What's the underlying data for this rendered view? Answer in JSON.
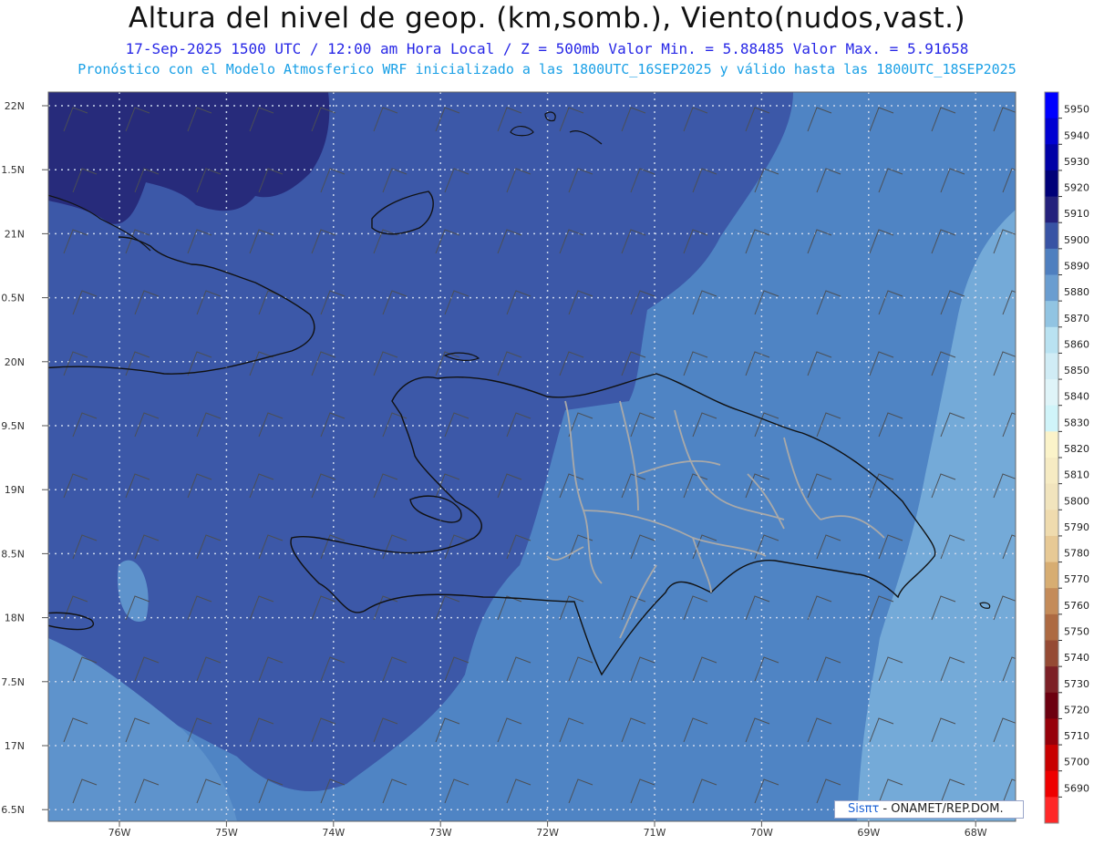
{
  "header": {
    "title": "Altura del nivel de geop. (km,somb.), Viento(nudos,vast.)",
    "subtitle": "17-Sep-2025  1500 UTC / 12:00 am Hora Local / Z = 500mb    Valor Min. = 5.88485  Valor Max. = 5.91658",
    "forecast": "Pronóstico con el Modelo Atmosferico WRF inicializado a las 1800UTC_16SEP2025 y válido hasta las  1800UTC_18SEP2025"
  },
  "axes": {
    "lat_ticks": [
      "22N",
      "1.5N",
      "21N",
      "0.5N",
      "20N",
      "9.5N",
      "19N",
      "8.5N",
      "18N",
      "7.5N",
      "17N",
      "6.5N"
    ],
    "lon_ticks": [
      "76W",
      "75W",
      "74W",
      "73W",
      "72W",
      "71W",
      "70W",
      "69W",
      "68W"
    ]
  },
  "colorbar": {
    "levels": [
      5950,
      5940,
      5930,
      5920,
      5910,
      5900,
      5890,
      5880,
      5870,
      5860,
      5850,
      5840,
      5830,
      5820,
      5810,
      5800,
      5790,
      5780,
      5770,
      5760,
      5750,
      5740,
      5730,
      5720,
      5710,
      5700,
      5690
    ],
    "colors": [
      "#0000ff",
      "#0000d2",
      "#0000a6",
      "#000078",
      "#24217c",
      "#3853a4",
      "#4f7fbf",
      "#6a9dd0",
      "#91c4e2",
      "#b9e2f1",
      "#d0ecf5",
      "#dff4f8",
      "#d0f4f9",
      "#fbf3c9",
      "#f6ebc3",
      "#f1e4bd",
      "#efdbae",
      "#e7c995",
      "#d7ad72",
      "#c48b59",
      "#ad6a42",
      "#954a34",
      "#7c2026",
      "#6c0010",
      "#96000a",
      "#c80000",
      "#ee0000",
      "#ff2828"
    ]
  },
  "field_colors": {
    "dark": "#272b7b",
    "mid": "#3c58a8",
    "light": "#4f84c4",
    "lighter": "#5e93cc",
    "lightest": "#74aad8"
  },
  "credit": {
    "brand": "Sisπτ",
    "text": " - ONAMET/REP.DOM."
  }
}
